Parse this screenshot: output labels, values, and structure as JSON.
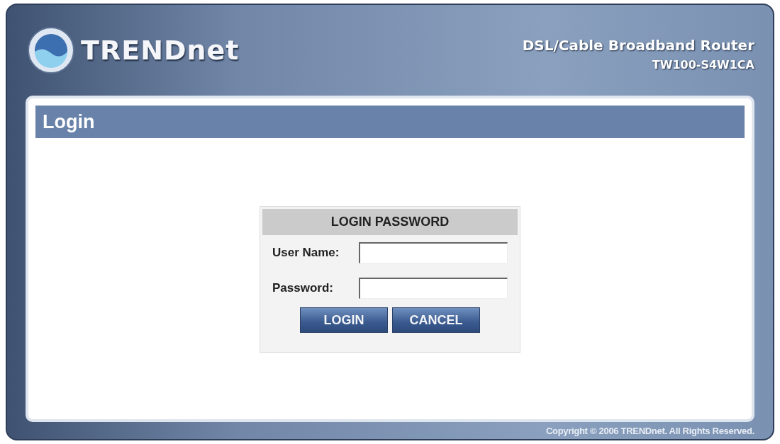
{
  "header": {
    "brand": "TRENDnet",
    "product": "DSL/Cable Broadband Router",
    "model": "TW100-S4W1CA"
  },
  "page_title": "Login",
  "login_box": {
    "title": "LOGIN PASSWORD",
    "fields": [
      {
        "label": "User Name:"
      },
      {
        "label": "Password:"
      }
    ],
    "buttons": [
      "LOGIN",
      "CANCEL"
    ]
  },
  "footer": "Copyright © 2006 TRENDnet. All Rights Reserved."
}
